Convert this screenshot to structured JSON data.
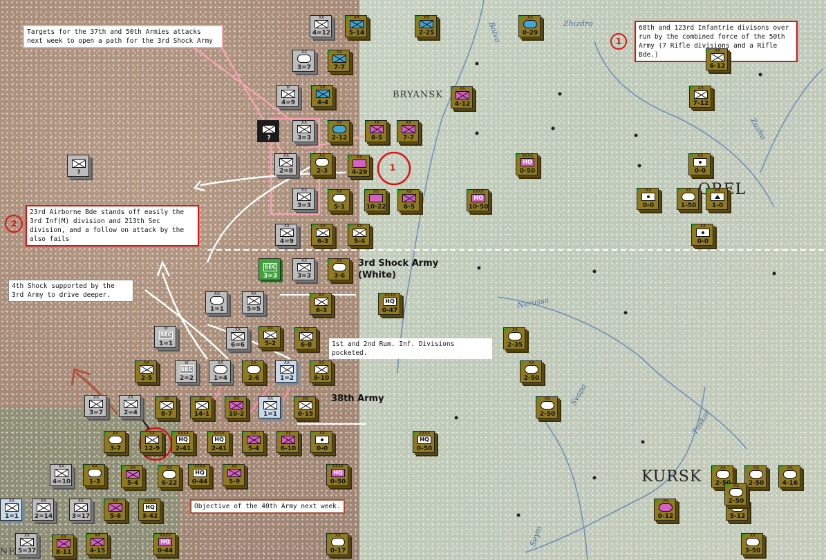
{
  "notes": {
    "targets": "Targets for the 37th and 50th Armies attacks next week to open a path for the 3rd Shock Army",
    "overrun": "68th and 123rd Infantrie divisons over run by the combined force of the 50th Army (7 Rifle divisions and a Rifle Bde.)",
    "airborne": "23rd Airborne Bde stands off easily the 3rd Inf(M) division and 213th Sec division, and a follow on attack by the also fails",
    "shock4": "4th Shock supported by the 3rd Army to drive deeper.",
    "pocketed": "1st and 2nd Rum. Inf. Divisions pocketed.",
    "objective": "Objective of the 40th Army next week."
  },
  "armies": {
    "shock3_line1": "3rd Shock Army",
    "shock3_line2": "(White)",
    "army38": "38th Army"
  },
  "cities": {
    "bryansk": "BRYANSK",
    "orel": "OREL",
    "kursk": "KURSK",
    "sumy_part": "NESOV"
  },
  "rivers": {
    "zhizdra": "Zhizdra",
    "bolva": "Bolva",
    "zusha": "Zusha",
    "nerussa": "Nerussa",
    "svapa": "Svapa",
    "tuskar": "Tuskar",
    "seym": "Seym"
  },
  "markers": {
    "one": "1",
    "two": "2",
    "three": "1"
  },
  "colors": {
    "axis": "#bdbdbd",
    "soviet": "#8f7a20",
    "annotation_red": "#dd1111",
    "annotation_pink": "#f4a3b1"
  },
  "units": [
    {
      "id": "u1",
      "size": "XX",
      "value": "4=12",
      "color": "gray",
      "sym": "inf"
    },
    {
      "id": "u2",
      "size": "XX",
      "value": "5-14",
      "color": "olive",
      "sym": "inf",
      "symcolor": "blue"
    },
    {
      "id": "u3",
      "size": "XX",
      "value": "2-25",
      "color": "olive",
      "sym": "inf",
      "symcolor": "blue"
    },
    {
      "id": "u4",
      "size": "XX",
      "value": "0-29",
      "color": "olive",
      "sym": "cav",
      "symcolor": "blue"
    },
    {
      "id": "u5",
      "size": "XX",
      "value": "6-12",
      "color": "olive",
      "sym": "inf"
    },
    {
      "id": "u6",
      "size": "XX",
      "value": "3=7",
      "color": "gray",
      "sym": "mot"
    },
    {
      "id": "u7",
      "size": "XX",
      "value": "7-7",
      "color": "olive",
      "sym": "inf",
      "symcolor": "blue"
    },
    {
      "id": "u8",
      "size": "III",
      "value": "4=9",
      "color": "gray",
      "sym": "inf"
    },
    {
      "id": "u9",
      "size": "XX",
      "value": "4-4",
      "color": "olive",
      "sym": "inf",
      "symcolor": "blue"
    },
    {
      "id": "u10",
      "size": "XX",
      "value": "4-12",
      "color": "olive",
      "sym": "inf",
      "symcolor": "pink"
    },
    {
      "id": "u11",
      "size": "XX",
      "value": "7-12",
      "color": "olive",
      "sym": "inf"
    },
    {
      "id": "u12",
      "size": "",
      "value": "?",
      "color": "black",
      "sym": "inf"
    },
    {
      "id": "u13",
      "size": "XX",
      "value": "3=3",
      "color": "gray",
      "sym": "inf"
    },
    {
      "id": "u14",
      "size": "XX",
      "value": "2-12",
      "color": "olive",
      "sym": "mot",
      "symcolor": "blue"
    },
    {
      "id": "u15",
      "size": "XX",
      "value": "8-5",
      "color": "olive",
      "sym": "inf",
      "symcolor": "pink"
    },
    {
      "id": "u16",
      "size": "XX",
      "value": "7-7",
      "color": "olive",
      "sym": "inf",
      "symcolor": "pink"
    },
    {
      "id": "u17",
      "size": "",
      "value": "?",
      "color": "gray",
      "sym": "inf"
    },
    {
      "id": "u18",
      "size": "XX",
      "value": "2=8",
      "color": "gray",
      "sym": "inf"
    },
    {
      "id": "u19",
      "size": "XX",
      "value": "2-3",
      "color": "olive",
      "sym": "mot"
    },
    {
      "id": "u20",
      "size": "XX",
      "value": "4-29",
      "color": "olive",
      "sym": "arm",
      "symcolor": "pink"
    },
    {
      "id": "u21",
      "size": "XXXX",
      "value": "0-50",
      "color": "olive",
      "sym": "hq",
      "symcolor": "pink",
      "label": "HQ"
    },
    {
      "id": "u22",
      "size": "XX",
      "value": "0-0",
      "color": "olive",
      "sym": "dot"
    },
    {
      "id": "u23",
      "size": "XX",
      "value": "3=3",
      "color": "gray",
      "sym": "inf"
    },
    {
      "id": "u24",
      "size": "XX",
      "value": "5-1",
      "color": "olive",
      "sym": "mot"
    },
    {
      "id": "u25",
      "size": "XX",
      "value": "10-22",
      "color": "olive",
      "sym": "arm",
      "symcolor": "pink"
    },
    {
      "id": "u26",
      "size": "XX",
      "value": "6-5",
      "color": "olive",
      "sym": "inf",
      "symcolor": "pink"
    },
    {
      "id": "u27",
      "size": "XXXX",
      "value": "10-50",
      "color": "olive",
      "sym": "hq",
      "symcolor": "pink",
      "label": "HQ"
    },
    {
      "id": "u28",
      "size": "XX",
      "value": "0-0",
      "color": "olive",
      "sym": "dot"
    },
    {
      "id": "u29",
      "size": "XX",
      "value": "1-50",
      "color": "olive",
      "sym": "mot"
    },
    {
      "id": "u30",
      "size": "XX",
      "value": "1-0",
      "color": "olive",
      "sym": "tri"
    },
    {
      "id": "u31",
      "size": "XX",
      "value": "4=9",
      "color": "gray",
      "sym": "inf"
    },
    {
      "id": "u32",
      "size": "XX",
      "value": "6-3",
      "color": "olive",
      "sym": "inf"
    },
    {
      "id": "u33",
      "size": "XX",
      "value": "5-4",
      "color": "olive",
      "sym": "inf"
    },
    {
      "id": "u34",
      "size": "XX",
      "value": "0-0",
      "color": "olive",
      "sym": "dot"
    },
    {
      "id": "u35",
      "size": "",
      "value": "3=3",
      "color": "green",
      "sym": "sec",
      "label": "SEC"
    },
    {
      "id": "u36",
      "size": "XX",
      "value": "3=3",
      "color": "gray",
      "sym": "inf"
    },
    {
      "id": "u37",
      "size": "XX",
      "value": "3-6",
      "color": "olive",
      "sym": "mot"
    },
    {
      "id": "u38",
      "size": "XX",
      "value": "1=1",
      "color": "gray",
      "sym": "mot"
    },
    {
      "id": "u39",
      "size": "XX",
      "value": "5=5",
      "color": "gray",
      "sym": "inf"
    },
    {
      "id": "u40",
      "size": "XX",
      "value": "6-3",
      "color": "olive",
      "sym": "inf"
    },
    {
      "id": "u41",
      "size": "XXXX",
      "value": "0-47",
      "color": "olive",
      "sym": "hq",
      "label": "HQ"
    },
    {
      "id": "u42",
      "size": "III",
      "value": "1=1",
      "color": "gray",
      "sym": "sec",
      "label": "SEC"
    },
    {
      "id": "u43",
      "size": "XX",
      "value": "6=6",
      "color": "gray",
      "sym": "inf"
    },
    {
      "id": "u44",
      "size": "XX",
      "value": "5-2",
      "color": "olive",
      "sym": "inf"
    },
    {
      "id": "u45",
      "size": "XX",
      "value": "6-8",
      "color": "olive",
      "sym": "inf"
    },
    {
      "id": "u46",
      "size": "XX",
      "value": "2-35",
      "color": "olive",
      "sym": "mot"
    },
    {
      "id": "u47",
      "size": "XX",
      "value": "2-5",
      "color": "olive",
      "sym": "inf"
    },
    {
      "id": "u48",
      "size": "III",
      "value": "2=2",
      "color": "gray",
      "sym": "sec",
      "label": "SEC"
    },
    {
      "id": "u49",
      "size": "XX",
      "value": "1=4",
      "color": "gray",
      "sym": "mot"
    },
    {
      "id": "u50",
      "size": "XX",
      "value": "2-6",
      "color": "olive",
      "sym": "mot"
    },
    {
      "id": "u51",
      "size": "XX",
      "value": "1=2",
      "color": "lightblue",
      "sym": "inf"
    },
    {
      "id": "u52",
      "size": "XX",
      "value": "9-10",
      "color": "olive",
      "sym": "inf"
    },
    {
      "id": "u53",
      "size": "XX",
      "value": "2-50",
      "color": "olive",
      "sym": "mot"
    },
    {
      "id": "u54",
      "size": "XX",
      "value": "3=7",
      "color": "gray",
      "sym": "inf"
    },
    {
      "id": "u55",
      "size": "XX",
      "value": "2=4",
      "color": "gray",
      "sym": "inf"
    },
    {
      "id": "u56",
      "size": "XX",
      "value": "8-7",
      "color": "olive",
      "sym": "inf"
    },
    {
      "id": "u57",
      "size": "XX",
      "value": "14-1",
      "color": "olive",
      "sym": "inf"
    },
    {
      "id": "u58",
      "size": "XX",
      "value": "10-2",
      "color": "olive",
      "sym": "inf",
      "symcolor": "pink"
    },
    {
      "id": "u59",
      "size": "XX",
      "value": "1=1",
      "color": "lightblue",
      "sym": "inf"
    },
    {
      "id": "u60",
      "size": "XX",
      "value": "8-15",
      "color": "olive",
      "sym": "inf"
    },
    {
      "id": "u61",
      "size": "XX",
      "value": "2-50",
      "color": "olive",
      "sym": "mot"
    },
    {
      "id": "u62",
      "size": "XX",
      "value": "3-7",
      "color": "olive",
      "sym": "mot"
    },
    {
      "id": "u63",
      "size": "XX",
      "value": "12-9",
      "color": "olive",
      "sym": "inf"
    },
    {
      "id": "u64",
      "size": "XXXX",
      "value": "2-41",
      "color": "olive",
      "sym": "hq",
      "label": "HQ"
    },
    {
      "id": "u65",
      "size": "XXXX",
      "value": "2-41",
      "color": "olive",
      "sym": "hq",
      "label": "HQ"
    },
    {
      "id": "u66",
      "size": "XX",
      "value": "5-4",
      "color": "olive",
      "sym": "inf",
      "symcolor": "pink"
    },
    {
      "id": "u67",
      "size": "XX",
      "value": "6-10",
      "color": "olive",
      "sym": "inf",
      "symcolor": "pink"
    },
    {
      "id": "u68",
      "size": "XX",
      "value": "0-0",
      "color": "olive",
      "sym": "dot"
    },
    {
      "id": "u69",
      "size": "XXXX",
      "value": "0-50",
      "color": "olive",
      "sym": "hq",
      "label": "HQ"
    },
    {
      "id": "u70",
      "size": "XX",
      "value": "4=10",
      "color": "gray",
      "sym": "inf"
    },
    {
      "id": "u71",
      "size": "XX",
      "value": "1-3",
      "color": "olive",
      "sym": "mot"
    },
    {
      "id": "u72",
      "size": "XX",
      "value": "5-4",
      "color": "olive",
      "sym": "inf",
      "symcolor": "pink"
    },
    {
      "id": "u73",
      "size": "XX",
      "value": "6-22",
      "color": "olive",
      "sym": "mot"
    },
    {
      "id": "u74",
      "size": "XXXX",
      "value": "0-44",
      "color": "olive",
      "sym": "hq",
      "label": "HQ"
    },
    {
      "id": "u75",
      "size": "XX",
      "value": "5-9",
      "color": "olive",
      "sym": "inf",
      "symcolor": "pink"
    },
    {
      "id": "u76",
      "size": "XXXX",
      "value": "0-50",
      "color": "olive",
      "sym": "hq",
      "symcolor": "pink",
      "label": "HQ"
    },
    {
      "id": "u77",
      "size": "XX",
      "value": "2-50",
      "color": "olive",
      "sym": "mot"
    },
    {
      "id": "u78",
      "size": "XX",
      "value": "2-50",
      "color": "olive",
      "sym": "mot"
    },
    {
      "id": "u79",
      "size": "XX",
      "value": "4-16",
      "color": "olive",
      "sym": "mot"
    },
    {
      "id": "u80",
      "size": "XX",
      "value": "1=1",
      "color": "lightblue",
      "sym": "inf"
    },
    {
      "id": "u81",
      "size": "XX",
      "value": "2=14",
      "color": "gray",
      "sym": "inf"
    },
    {
      "id": "u82",
      "size": "XX",
      "value": "3=17",
      "color": "gray",
      "sym": "inf"
    },
    {
      "id": "u83",
      "size": "XX",
      "value": "5-6",
      "color": "olive",
      "sym": "inf",
      "symcolor": "pink"
    },
    {
      "id": "u84",
      "size": "XXXX",
      "value": "3-42",
      "color": "olive",
      "sym": "hq",
      "label": "HQ"
    },
    {
      "id": "u85",
      "size": "XX",
      "value": "0-12",
      "color": "olive",
      "sym": "cav",
      "symcolor": "pink"
    },
    {
      "id": "u86",
      "size": "XX",
      "value": "5-12",
      "color": "olive",
      "sym": "mot"
    },
    {
      "id": "u87",
      "size": "XX",
      "value": "5=37",
      "color": "gray",
      "sym": "inf"
    },
    {
      "id": "u88",
      "size": "XX",
      "value": "8-11",
      "color": "olive",
      "sym": "inf",
      "symcolor": "pink"
    },
    {
      "id": "u89",
      "size": "XX",
      "value": "4-15",
      "color": "olive",
      "sym": "inf",
      "symcolor": "pink"
    },
    {
      "id": "u90",
      "size": "XXXX",
      "value": "0-44",
      "color": "olive",
      "sym": "hq",
      "symcolor": "pink",
      "label": "HQ"
    },
    {
      "id": "u91",
      "size": "XX",
      "value": "0-17",
      "color": "olive",
      "sym": "cav"
    },
    {
      "id": "u92",
      "size": "XX",
      "value": "3-50",
      "color": "olive",
      "sym": "mot"
    },
    {
      "id": "u93",
      "size": "XX",
      "value": "2-50",
      "color": "olive",
      "sym": "mot"
    }
  ]
}
